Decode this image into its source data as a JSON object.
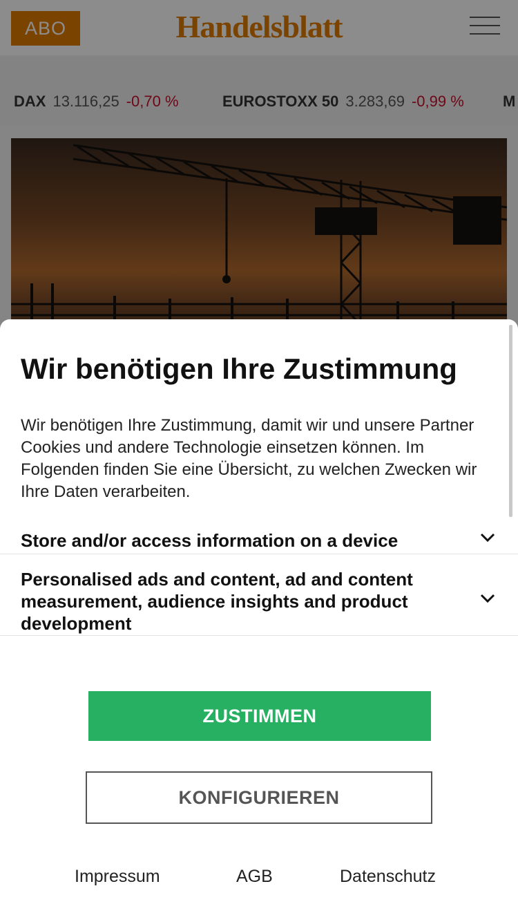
{
  "header": {
    "abo_label": "ABO",
    "logo_text": "Handelsblatt"
  },
  "ticker": [
    {
      "name": "DAX",
      "value": "13.116,25",
      "change": "-0,70 %"
    },
    {
      "name": "EUROSTOXX 50",
      "value": "3.283,69",
      "change": "-0,99 %"
    },
    {
      "name": "M",
      "value": "",
      "change": ""
    }
  ],
  "consent": {
    "title": "Wir benötigen Ihre Zustimmung",
    "intro": "Wir benötigen Ihre Zustimmung, damit wir und unsere Partner Cookies und andere Technologie einsetzen können. Im Folgenden finden Sie eine Übersicht, zu welchen Zwecken wir Ihre Daten verarbeiten.",
    "purposes": [
      {
        "label": "Store and/or access information on a device",
        "icon": "chevron-down-icon"
      },
      {
        "label": "Personalised ads and content, ad and content measurement, audience insights and product development",
        "icon": "chevron-down-icon"
      }
    ],
    "agree_label": "ZUSTIMMEN",
    "configure_label": "KONFIGURIEREN",
    "footer_links": [
      "Impressum",
      "AGB",
      "Datenschutz"
    ]
  },
  "colors": {
    "brand": "#e07b00",
    "agree": "#28b062",
    "negative": "#c8102e"
  }
}
